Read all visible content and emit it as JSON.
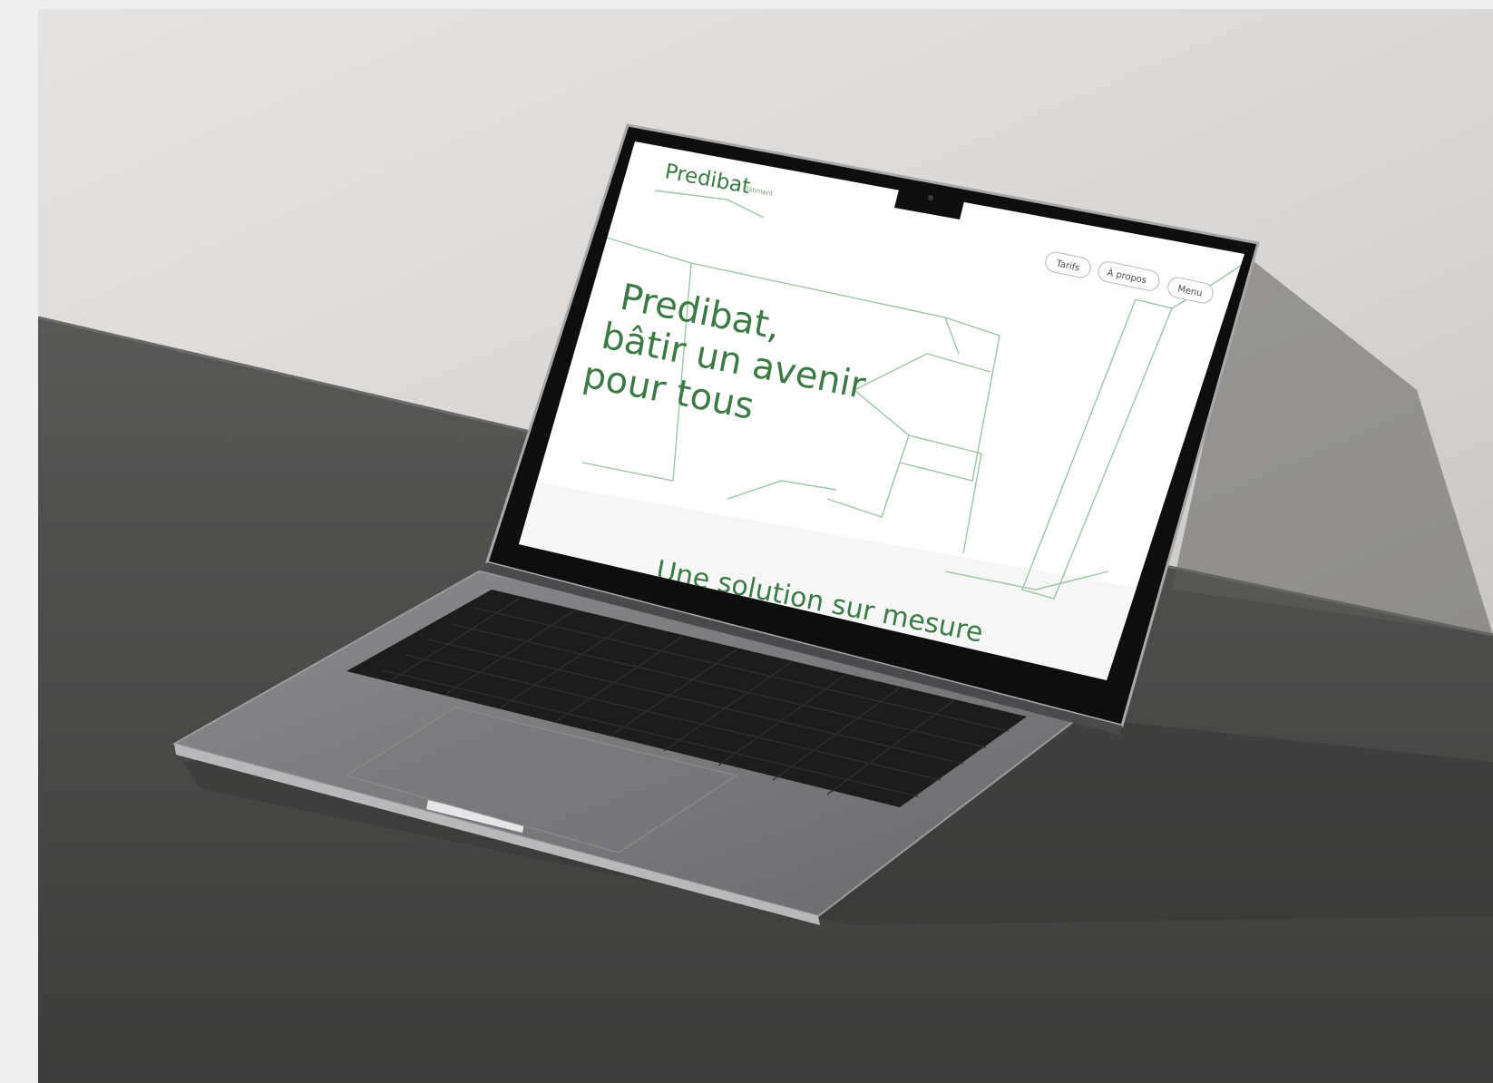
{
  "scene": {
    "description_free": true,
    "colors": {
      "page_bg": "#efefef",
      "wall": "#dcdad8",
      "floor": "#4b4b4a",
      "laptop_body": "#7c7c7e",
      "keyboard": "#1c1c1d",
      "screen_bg": "#ffffff",
      "accent_green": "#3c7a45",
      "line_green": "#9cc4a3"
    }
  },
  "website": {
    "logo": "Predibat",
    "logo_tag": "Bâtiment",
    "nav": {
      "pricing": "Tarifs",
      "about": "À propos",
      "menu": "Menu"
    },
    "hero_line1": "Predibat,",
    "hero_line2": "bâtir un avenir",
    "hero_line3": "pour tous",
    "section_title": "Une solution sur mesure"
  }
}
